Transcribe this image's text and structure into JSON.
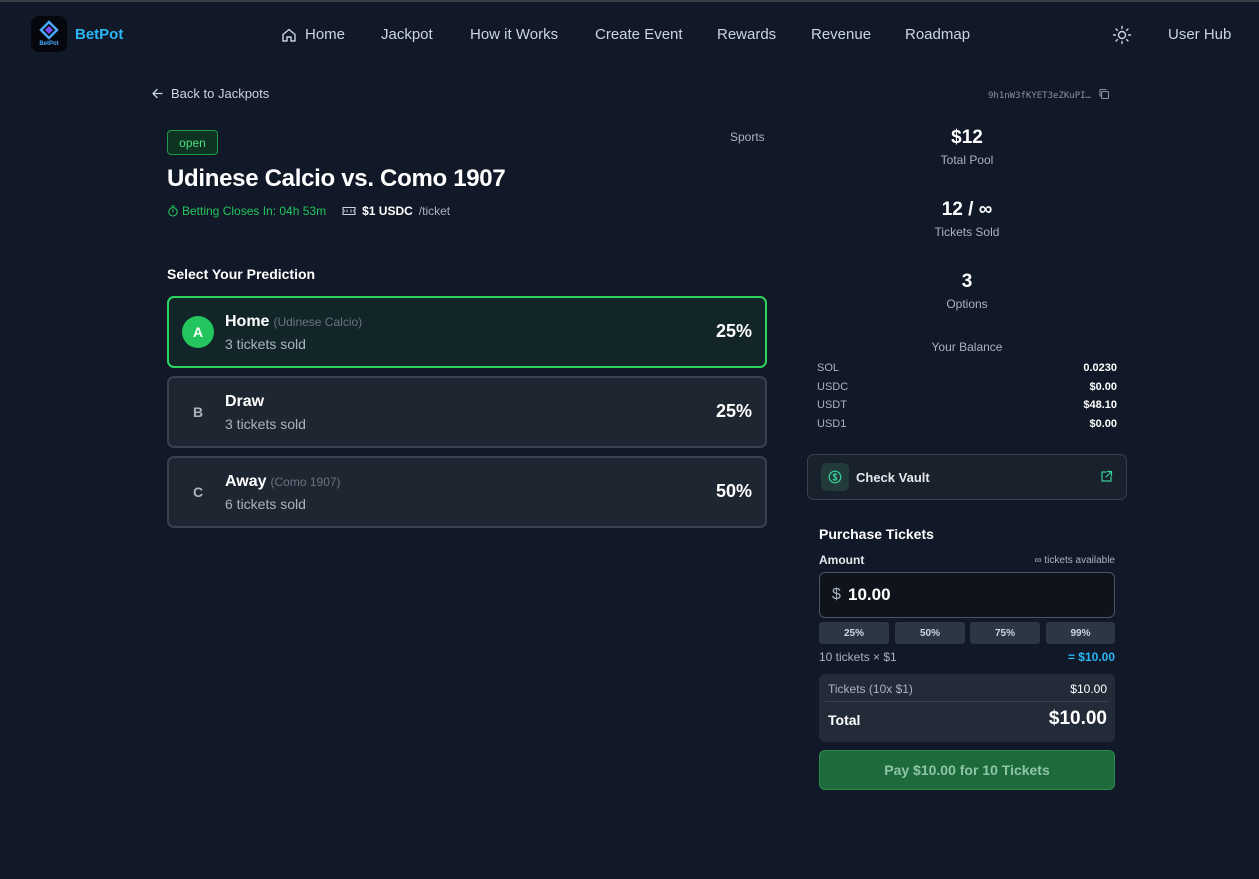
{
  "header": {
    "logo_mini": "BetPot",
    "brand": "BetPot",
    "nav": [
      "Home",
      "Jackpot",
      "How it Works",
      "Create Event",
      "Rewards",
      "Revenue",
      "Roadmap"
    ],
    "user_hub": "User Hub"
  },
  "back_label": "Back to Jackpots",
  "address": "9h1nW3fKYET3eZKuPI…",
  "event": {
    "status": "open",
    "category": "Sports",
    "title": "Udinese Calcio vs. Como 1907",
    "closes": "Betting Closes In: 04h 53m",
    "price": "$1 USDC",
    "per_ticket": "/ticket"
  },
  "prediction_title": "Select Your Prediction",
  "options": [
    {
      "letter": "A",
      "name": "Home",
      "sub": "(Udinese Calcio)",
      "tickets": "3 tickets sold",
      "pct": "25%"
    },
    {
      "letter": "B",
      "name": "Draw",
      "sub": "",
      "tickets": "3 tickets sold",
      "pct": "25%"
    },
    {
      "letter": "C",
      "name": "Away",
      "sub": "(Como 1907)",
      "tickets": "6 tickets sold",
      "pct": "50%"
    }
  ],
  "stats": {
    "pool_value": "$12",
    "pool_label": "Total Pool",
    "sold_value": "12 / ∞",
    "sold_label": "Tickets Sold",
    "options_value": "3",
    "options_label": "Options"
  },
  "balance": {
    "title": "Your Balance",
    "rows": [
      {
        "k": "SOL",
        "v": "0.0230"
      },
      {
        "k": "USDC",
        "v": "$0.00"
      },
      {
        "k": "USDT",
        "v": "$48.10"
      },
      {
        "k": "USD1",
        "v": "$0.00"
      }
    ]
  },
  "vault_label": "Check Vault",
  "purchase": {
    "title": "Purchase Tickets",
    "amount_label": "Amount",
    "available": "∞ tickets available",
    "currency": "$",
    "amount_value": "10.00",
    "pct_buttons": [
      "25%",
      "50%",
      "75%",
      "99%"
    ],
    "calc_left": "10 tickets × $1",
    "calc_right": "= $10.00",
    "line_label": "Tickets (10x $1)",
    "line_value": "$10.00",
    "total_label": "Total",
    "total_value": "$10.00",
    "pay_label": "Pay $10.00 for 10 Tickets"
  },
  "colors": {
    "background": "#111827",
    "accent_green": "#22c55e",
    "accent_blue": "#29b6f6"
  }
}
